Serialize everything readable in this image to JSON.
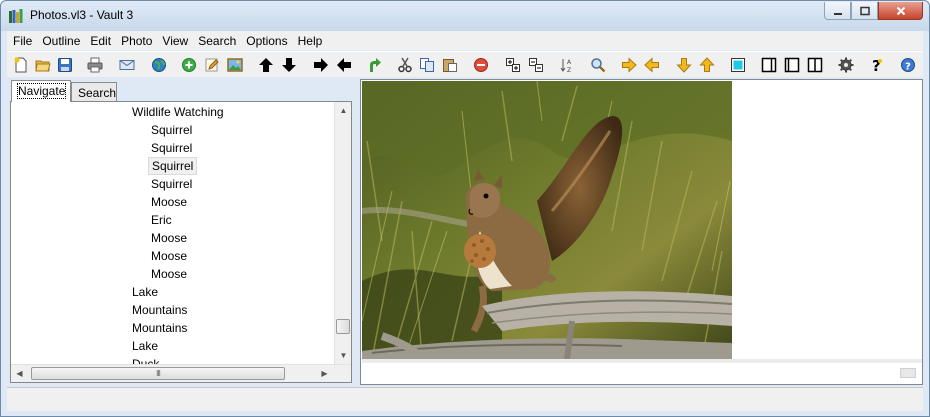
{
  "window": {
    "title": "Photos.vl3 - Vault 3"
  },
  "menu": [
    {
      "id": "file",
      "label": "File"
    },
    {
      "id": "outline",
      "label": "Outline"
    },
    {
      "id": "edit",
      "label": "Edit"
    },
    {
      "id": "photo",
      "label": "Photo"
    },
    {
      "id": "view",
      "label": "View"
    },
    {
      "id": "search",
      "label": "Search"
    },
    {
      "id": "options",
      "label": "Options"
    },
    {
      "id": "help",
      "label": "Help"
    }
  ],
  "toolbar": {
    "icons": [
      "new-file-icon",
      "open-folder-icon",
      "save-icon",
      "print-icon",
      "email-icon",
      "globe-icon",
      "add-icon",
      "edit-icon",
      "insert-picture-icon",
      "arrow-up-icon",
      "arrow-down-icon",
      "arrow-right-icon",
      "arrow-left-icon",
      "redo-icon",
      "cut-icon",
      "copy-icon",
      "paste-icon",
      "delete-icon",
      "expand-all-icon",
      "collapse-all-icon",
      "sort-icon",
      "find-icon",
      "next-icon",
      "previous-icon",
      "move-down-icon",
      "move-up-icon",
      "toggle-view-icon",
      "layout-left-icon",
      "layout-single-icon",
      "layout-split-icon",
      "settings-icon",
      "help-icon",
      "about-icon"
    ]
  },
  "tabs": [
    {
      "id": "navigate",
      "label": "Navigate",
      "active": true
    },
    {
      "id": "search",
      "label": "Search",
      "active": false
    }
  ],
  "tree": {
    "items": [
      {
        "label": "Wildlife Watching",
        "level": 1,
        "selected": false
      },
      {
        "label": "Squirrel",
        "level": 2,
        "selected": false
      },
      {
        "label": "Squirrel",
        "level": 2,
        "selected": false
      },
      {
        "label": "Squirrel",
        "level": 2,
        "selected": true
      },
      {
        "label": "Squirrel",
        "level": 2,
        "selected": false
      },
      {
        "label": "Moose",
        "level": 2,
        "selected": false
      },
      {
        "label": "Eric",
        "level": 2,
        "selected": false
      },
      {
        "label": "Moose",
        "level": 2,
        "selected": false
      },
      {
        "label": "Moose",
        "level": 2,
        "selected": false
      },
      {
        "label": "Moose",
        "level": 2,
        "selected": false
      },
      {
        "label": "Lake",
        "level": 1,
        "selected": false
      },
      {
        "label": "Mountains",
        "level": 1,
        "selected": false
      },
      {
        "label": "Mountains",
        "level": 1,
        "selected": false
      },
      {
        "label": "Lake",
        "level": 1,
        "selected": false
      },
      {
        "label": "Duck",
        "level": 1,
        "selected": false
      }
    ],
    "hscroll_grip": "III"
  },
  "colors": {
    "accent_blue": "#1f5fb8",
    "titlebar": "#c8d9ec",
    "close_red": "#c7432a"
  }
}
